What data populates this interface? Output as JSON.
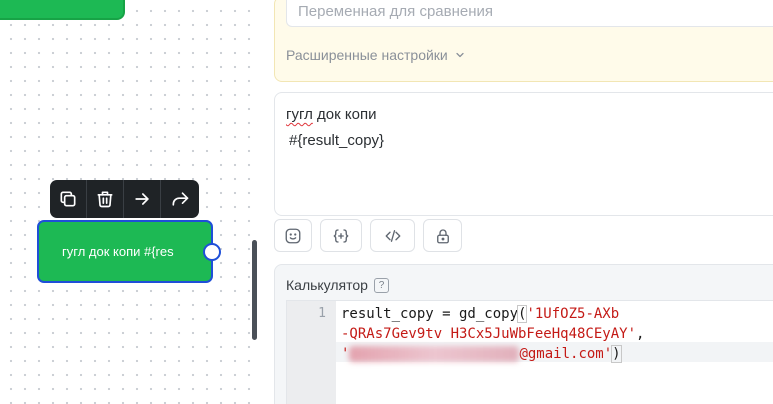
{
  "canvas": {
    "node": {
      "label": "гугл док копи  #{res"
    },
    "toolbar": {
      "items": [
        {
          "name": "copy-icon"
        },
        {
          "name": "trash-icon"
        },
        {
          "name": "arrow-right-icon"
        },
        {
          "name": "share-icon"
        }
      ]
    }
  },
  "panel": {
    "comparison": {
      "placeholder": "Переменная для сравнения",
      "advanced_label": "Расширенные настройки"
    },
    "message": {
      "line1_word": "гугл",
      "line1_rest": " док копи",
      "line2": "#{result_copy}"
    },
    "tools": [
      "emoji-icon",
      "variable-braces-icon",
      "code-icon",
      "lock-icon"
    ],
    "calculator": {
      "title": "Калькулятор",
      "help": "?",
      "line_number": "1",
      "code": {
        "l1_prefix": "result_copy = gd_copy",
        "l1_paren": "(",
        "l1_str": "'1UfOZ5-AXb",
        "l2_str": "-QRAs7Gev9tv H3Cx5JuWbFeeHq48CEyAY'",
        "l2_comma": ",",
        "l3_quote": "'",
        "l3_str": "@gmail.com'",
        "l3_paren": ")"
      }
    }
  },
  "colors": {
    "node_green": "#1db954",
    "node_border": "#1e4fd8",
    "toolbar_bg": "#1f2326",
    "yellow_card": "#fffbea",
    "code_string": "#c41a16"
  }
}
